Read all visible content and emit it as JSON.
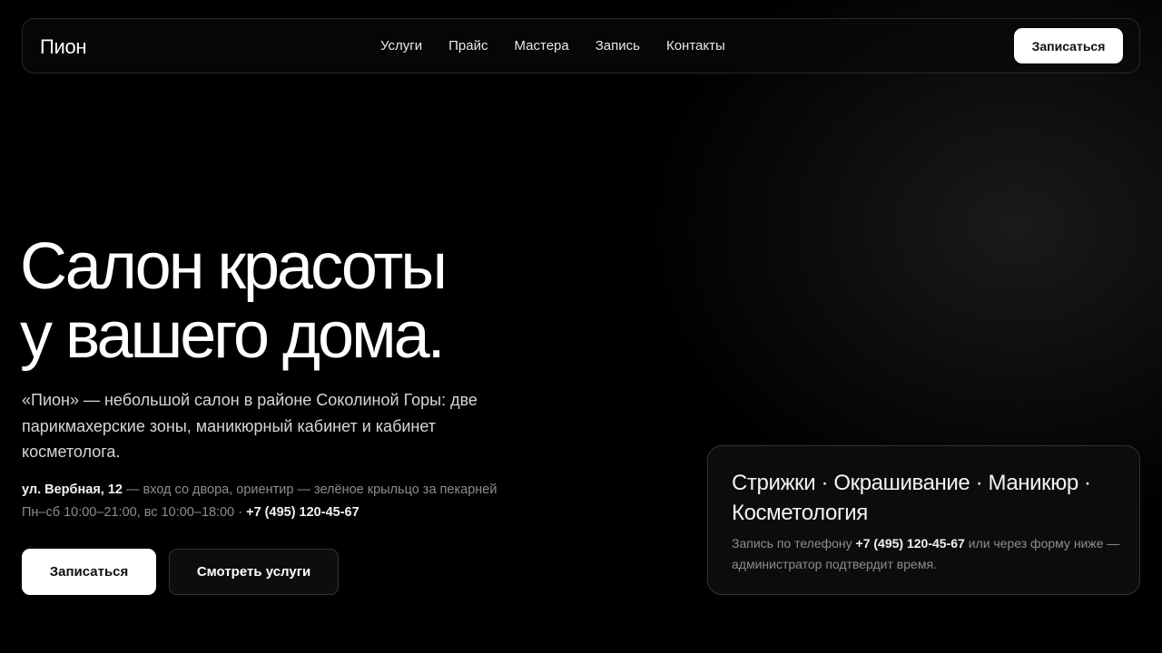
{
  "nav": {
    "logo": "Пион",
    "items": [
      "Услуги",
      "Прайс",
      "Мастера",
      "Запись",
      "Контакты"
    ],
    "cta": "Записаться"
  },
  "hero": {
    "title_line1": "Салон красоты",
    "title_line2": "у вашего дома.",
    "description": "«Пион» — небольшой салон в районе Соколиной Горы: две парикмахерские зоны, маникюрный кабинет и кабинет косметолога.",
    "address": "ул. Вербная, 12",
    "address_note": " — вход со двора, ориентир — зелёное крыльцо за пекарней",
    "hours": "Пн–сб 10:00–21:00, вс 10:00–18:00 · ",
    "phone": "+7 (495) 120-45-67",
    "primary_button": "Записаться",
    "secondary_button": "Смотреть услуги"
  },
  "card": {
    "services": "Стрижки · Окрашивание · Маникюр · Косметология",
    "text_before_phone": "Запись по телефону ",
    "phone": "+7 (495) 120-45-67",
    "text_after_phone": " или через форму ниже — администратор подтвердит время."
  },
  "colors": {
    "background": "#000000",
    "button_bg": "#ffffff",
    "muted_text": "#8d8d8d"
  }
}
